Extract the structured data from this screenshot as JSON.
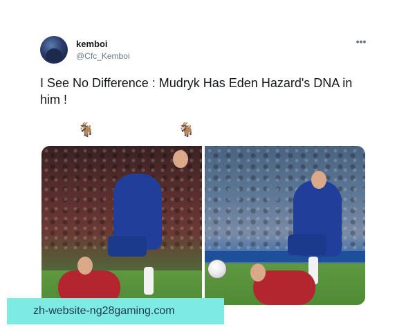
{
  "tweet": {
    "display_name": "kemboi",
    "handle": "@Cfc_Kemboi",
    "more_label": "•••",
    "text": "I See No Difference : Mudryk Has Eden Hazard's DNA in him !",
    "emojis": [
      "🐐",
      "🐐"
    ]
  },
  "watermark": {
    "text": "zh-website-ng28gaming.com"
  }
}
